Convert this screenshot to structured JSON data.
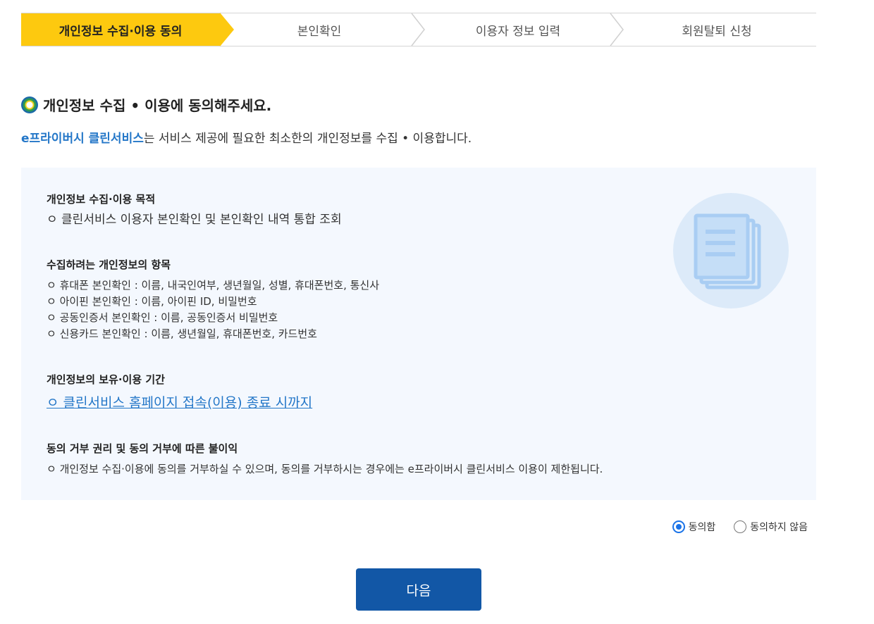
{
  "steps": [
    {
      "label": "개인정보 수집·이용 동의",
      "active": true
    },
    {
      "label": "본인확인",
      "active": false
    },
    {
      "label": "이용자 정보 입력",
      "active": false
    },
    {
      "label": "회원탈퇴 신청",
      "active": false
    }
  ],
  "heading": "개인정보 수집 • 이용에 동의해주세요.",
  "intro": {
    "brand": "e프라이버시 클린서비스",
    "text": "는 서비스 제공에 필요한 최소한의 개인정보를 수집 • 이용합니다."
  },
  "sections": {
    "purpose": {
      "title": "개인정보 수집·이용 목적",
      "items": [
        "ㅇ 클린서비스 이용자 본인확인 및 본인확인 내역 통합 조회"
      ]
    },
    "items": {
      "title": "수집하려는 개인정보의 항목",
      "items": [
        "ㅇ 휴대폰 본인확인 : 이름, 내국인여부, 생년월일, 성별, 휴대폰번호, 통신사",
        "ㅇ 아이핀 본인확인 : 이름, 아이핀 ID, 비밀번호",
        "ㅇ 공동인증서 본인확인 : 이름, 공동인증서 비밀번호",
        "ㅇ 신용카드 본인확인 : 이름, 생년월일, 휴대폰번호, 카드번호"
      ]
    },
    "retention": {
      "title": "개인정보의 보유·이용 기간",
      "link": "ㅇ 클린서비스 홈페이지 접속(이용) 종료 시까지"
    },
    "refusal": {
      "title": "동의 거부 권리 및 동의 거부에 따른 불이익",
      "items": [
        "ㅇ 개인정보 수집·이용에 동의를 거부하실 수 있으며, 동의를 거부하시는 경우에는 e프라이버시 클린서비스 이용이 제한됩니다."
      ]
    }
  },
  "consent": {
    "agree": "동의함",
    "disagree": "동의하지 않음",
    "selected": "agree"
  },
  "next_label": "다음",
  "colors": {
    "active_step": "#fdc90f",
    "brand": "#2477c8",
    "panel_bg": "#f4f8fe",
    "button": "#1257a6"
  }
}
